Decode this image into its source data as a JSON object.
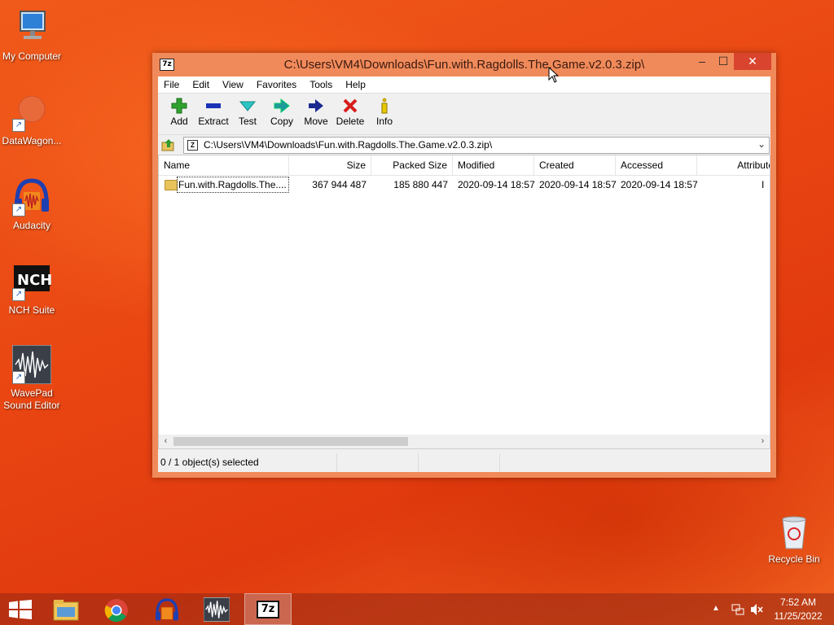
{
  "desktop": {
    "icons": [
      {
        "label": "My Computer"
      },
      {
        "label": "DataWagon..."
      },
      {
        "label": "Audacity"
      },
      {
        "label": "NCH Suite"
      },
      {
        "label": "WavePad Sound Editor",
        "label_line1": "WavePad",
        "label_line2": "Sound Editor"
      },
      {
        "label": "Recycle Bin"
      }
    ]
  },
  "window": {
    "title": "C:\\Users\\VM4\\Downloads\\Fun.with.Ragdolls.The.Game.v2.0.3.zip\\",
    "title_icon": "7z",
    "controls": {
      "minimize": "–",
      "maximize": "☐",
      "close": "✕"
    },
    "menu": [
      "File",
      "Edit",
      "View",
      "Favorites",
      "Tools",
      "Help"
    ],
    "toolbar": [
      {
        "label": "Add",
        "icon": "plus-icon",
        "color": "#2fa12f"
      },
      {
        "label": "Extract",
        "icon": "minus-icon",
        "color": "#1a33b5"
      },
      {
        "label": "Test",
        "icon": "check-icon",
        "color": "#1fb0b0"
      },
      {
        "label": "Copy",
        "icon": "double-arrow-icon",
        "color": "#1f9a9a"
      },
      {
        "label": "Move",
        "icon": "arrow-right-icon",
        "color": "#1a2a8f"
      },
      {
        "label": "Delete",
        "icon": "x-icon",
        "color": "#d81c1c"
      },
      {
        "label": "Info",
        "icon": "info-icon",
        "color": "#c9a800"
      }
    ],
    "address": "C:\\Users\\VM4\\Downloads\\Fun.with.Ragdolls.The.Game.v2.0.3.zip\\",
    "columns": [
      "Name",
      "Size",
      "Packed Size",
      "Modified",
      "Created",
      "Accessed",
      "Attribute"
    ],
    "rows": [
      {
        "name": "Fun.with.Ragdolls.The....",
        "size": "367 944 487",
        "packed_size": "185 880 447",
        "modified": "2020-09-14 18:57",
        "created": "2020-09-14 18:57",
        "accessed": "2020-09-14 18:57",
        "attribute": "I"
      }
    ],
    "status": "0 / 1 object(s) selected"
  },
  "taskbar": {
    "apps": [
      "Start",
      "File Explorer",
      "Google Chrome",
      "Audacity",
      "WavePad",
      "7-Zip"
    ],
    "active_app": "7-Zip",
    "active_icon": "7z",
    "clock_time": "7:52 AM",
    "clock_date": "11/25/2022"
  }
}
